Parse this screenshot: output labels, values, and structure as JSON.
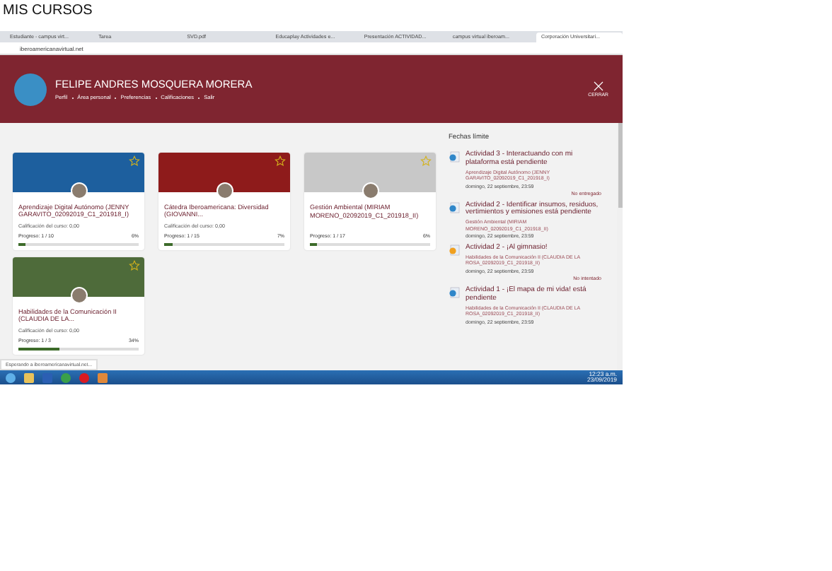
{
  "page_title": "MIS CURSOS",
  "browser": {
    "tabs": [
      {
        "label": "Estudiante - campus virt...",
        "selected": false
      },
      {
        "label": "Tarea",
        "selected": false
      },
      {
        "label": "SVD.pdf",
        "selected": false
      },
      {
        "label": "Educaplay Actividades e...",
        "selected": false
      },
      {
        "label": "Presentación ACTIVIDAD...",
        "selected": false
      },
      {
        "label": "campus virtual iberoam...",
        "selected": false
      },
      {
        "label": "Corporación Universitari...",
        "selected": true
      }
    ],
    "address": "iberoamericanavirtual.net"
  },
  "header": {
    "name": "FELIPE ANDRES MOSQUERA MORERA",
    "menu": [
      "Perfil",
      "Área personal",
      "Preferencias",
      "Calificaciones",
      "Salir"
    ],
    "close_label": "CERRAR"
  },
  "courses": [
    {
      "title": "Aprendizaje Digital Autónomo (JENNY GARAVITO_02092019_C1_201918_I)",
      "grade": "Calificación del curso: 0,00",
      "progress": "Progreso: 1 / 10",
      "percent": "6%",
      "level": 0.06,
      "starred": false
    },
    {
      "title": "Cátedra Iberoamericana: Diversidad (GIOVANNI...",
      "grade": "Calificación del curso: 0,00",
      "progress": "Progreso: 1 / 15",
      "percent": "7%",
      "level": 0.07,
      "starred": false
    },
    {
      "title": "Gestión Ambiental (MIRIAM MORENO_02092019_C1_201918_II)",
      "progress": "Progreso: 1 / 17",
      "percent": "6%",
      "level": 0.06,
      "starred": false
    },
    {
      "title": "Habilidades de la Comunicación II (CLAUDIA DE LA...",
      "grade": "Calificación del curso: 0,00",
      "progress": "Progreso: 1 / 3",
      "percent": "34%",
      "level": 0.34,
      "starred": false
    }
  ],
  "deadlines": {
    "title": "Fechas límite",
    "items": [
      {
        "kind": "assignment",
        "title": "Actividad 3 - Interactuando con mi plataforma está pendiente",
        "course": "Aprendizaje Digital Autónomo (JENNY GARAVITO_02092019_C1_201918_I)",
        "date": "domingo, 22 septiembre, 23:59",
        "status": "No entregado"
      },
      {
        "kind": "assignment",
        "title": "Actividad 2 - Identificar insumos, residuos, vertimientos y emisiones está pendiente",
        "course": "Gestión Ambiental (MIRIAM MORENO_02092019_C1_201918_II)",
        "date": "domingo, 22 septiembre, 23:59"
      },
      {
        "kind": "quiz",
        "title": "Actividad 2 - ¡Al gimnasio!",
        "course": "Habilidades de la Comunicación II (CLAUDIA DE LA ROSA_02092019_C1_201918_II)",
        "date": "domingo, 22 septiembre, 23:59",
        "status": "No intentado"
      },
      {
        "kind": "assignment",
        "title": "Actividad 1 - ¡El mapa de mi vida! está pendiente",
        "course": "Habilidades de la Comunicación II (CLAUDIA DE LA ROSA_02092019_C1_201918_II)",
        "date": "domingo, 22 septiembre, 23:59"
      }
    ]
  },
  "status_text": "Esperando a iberoamericanavirtual.net...",
  "taskbar": {
    "time": "12:23 a.m.",
    "date": "23/09/2019"
  }
}
